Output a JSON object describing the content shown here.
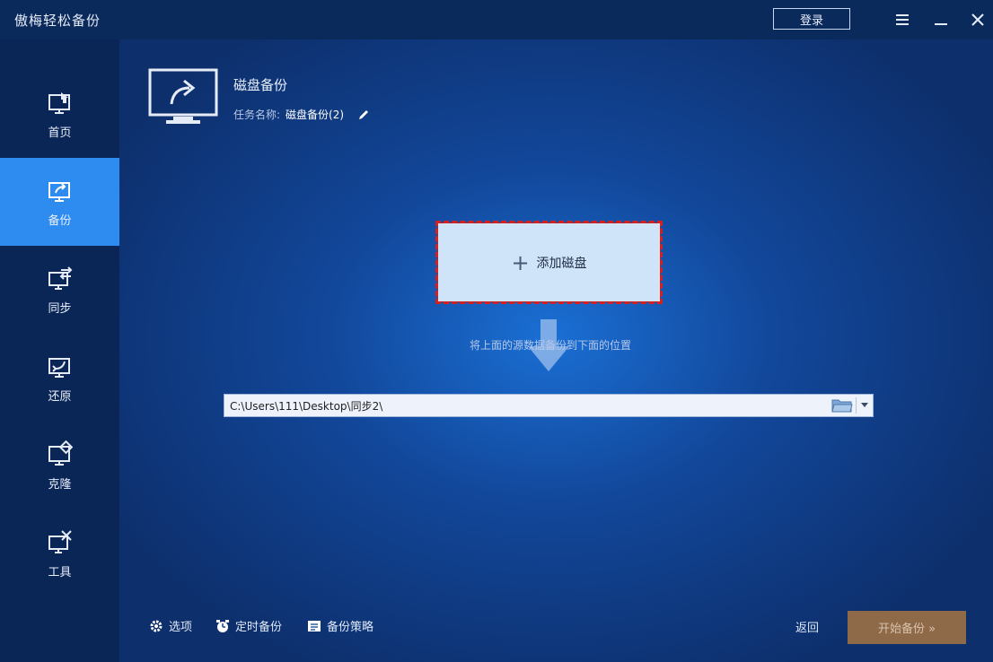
{
  "app": {
    "title": "傲梅轻松备份",
    "login_label": "登录"
  },
  "sidebar": {
    "items": [
      {
        "label": "首页",
        "icon": "home-icon"
      },
      {
        "label": "备份",
        "icon": "backup-icon"
      },
      {
        "label": "同步",
        "icon": "sync-icon"
      },
      {
        "label": "还原",
        "icon": "restore-icon"
      },
      {
        "label": "克隆",
        "icon": "clone-icon"
      },
      {
        "label": "工具",
        "icon": "tools-icon"
      }
    ],
    "active": "备份"
  },
  "header": {
    "title": "磁盘备份",
    "task_label": "任务名称:",
    "task_name": "磁盘备份(2)"
  },
  "source": {
    "add_label": "添加磁盘"
  },
  "hint": "将上面的源数据备份到下面的位置",
  "destination": {
    "path": "C:\\Users\\111\\Desktop\\同步2\\"
  },
  "footer": {
    "options_label": "选项",
    "schedule_label": "定时备份",
    "strategy_label": "备份策略",
    "back_label": "返回",
    "start_label": "开始备份 »"
  },
  "colors": {
    "accent": "#2e8bef",
    "highlight_border": "#d42020",
    "start_button": "#8f6a49"
  }
}
